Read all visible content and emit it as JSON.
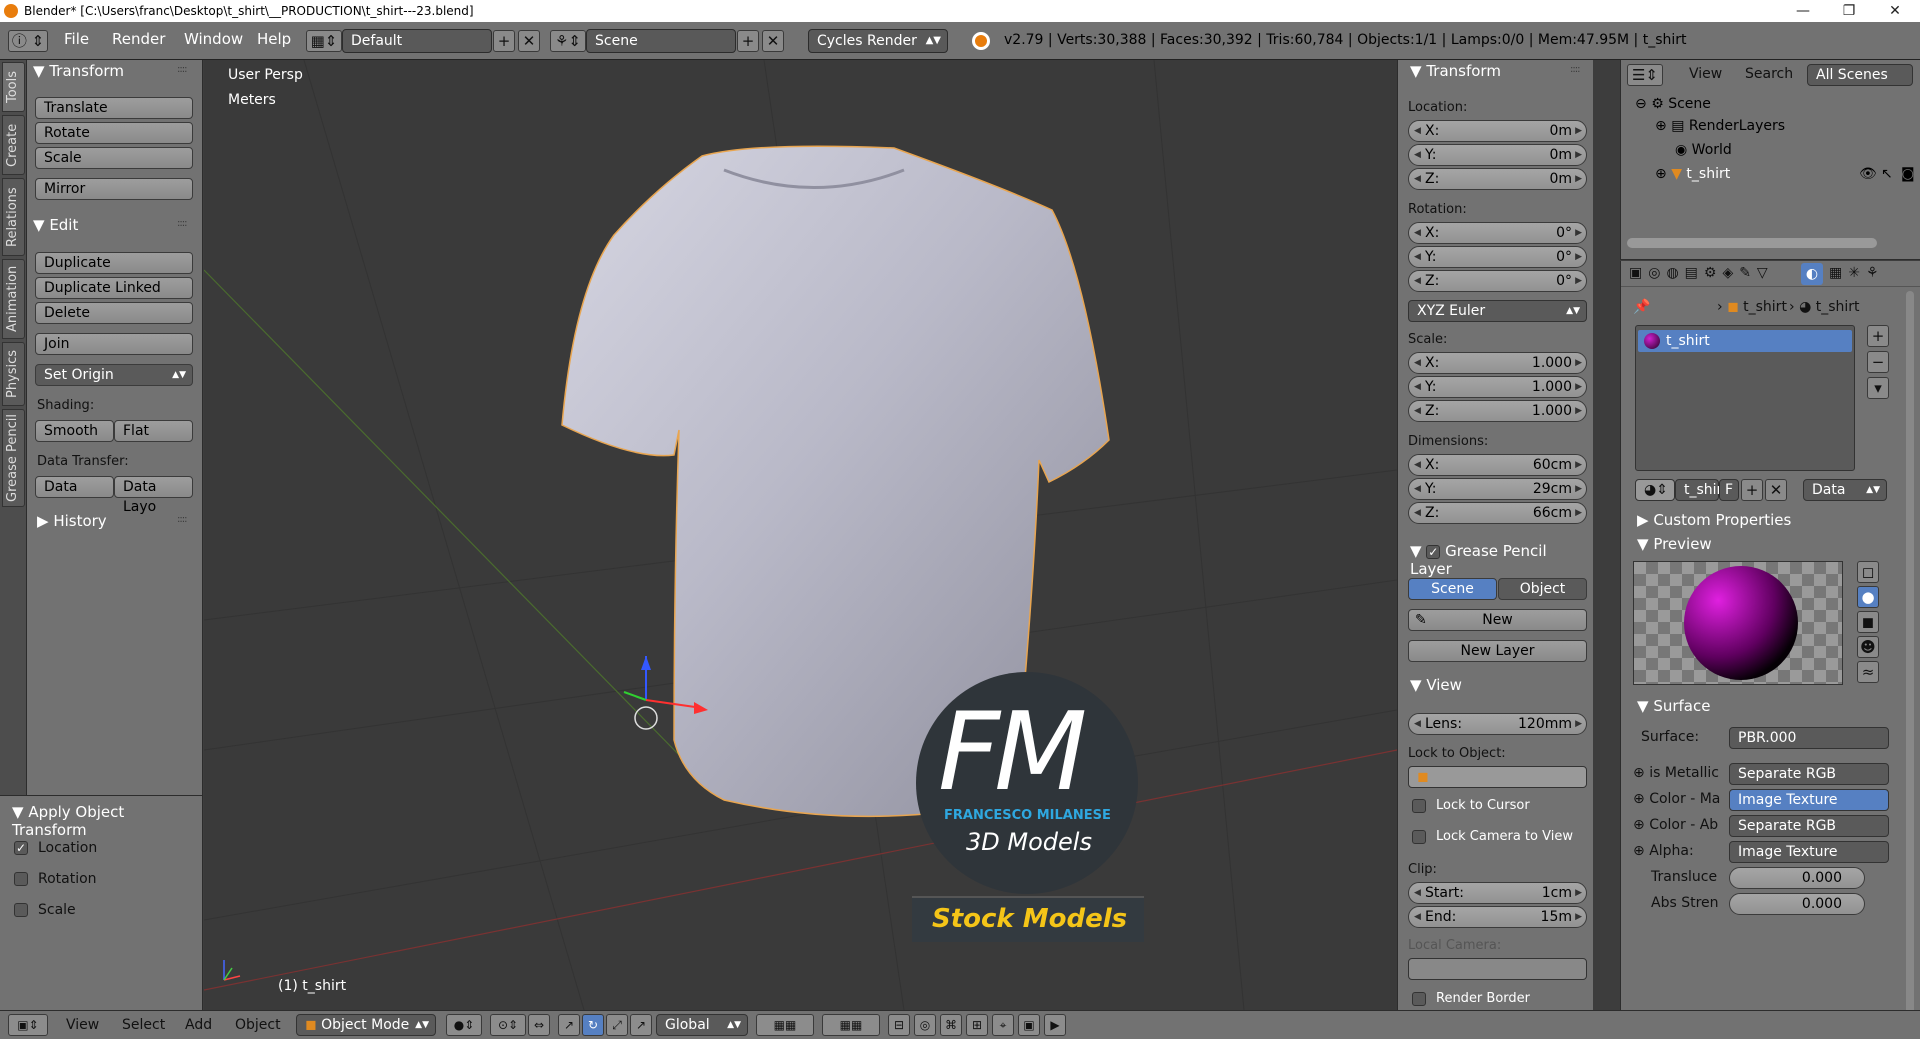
{
  "window": {
    "title": "Blender* [C:\\Users\\franc\\Desktop\\t_shirt\\__PRODUCTION\\t_shirt---23.blend]",
    "minimize": "—",
    "maximize": "❐",
    "close": "✕"
  },
  "infobar": {
    "menus": [
      "File",
      "Render",
      "Window",
      "Help"
    ],
    "screen_layout": "Default",
    "scene": "Scene",
    "engine": "Cycles Render",
    "stats": "v2.79 | Verts:30,388 | Faces:30,392 | Tris:60,784 | Objects:1/1 | Lamps:0/0 | Mem:47.95M | t_shirt"
  },
  "tool_tabs": [
    "Tools",
    "Create",
    "Relations",
    "Animation",
    "Physics",
    "Grease Pencil"
  ],
  "toolshelf": {
    "transform_header": "Transform",
    "transform_buttons": [
      "Translate",
      "Rotate",
      "Scale"
    ],
    "mirror": "Mirror",
    "edit_header": "Edit",
    "edit_buttons": [
      "Duplicate",
      "Duplicate Linked",
      "Delete"
    ],
    "join": "Join",
    "set_origin": "Set Origin",
    "shading_label": "Shading:",
    "smooth": "Smooth",
    "flat": "Flat",
    "data_transfer_label": "Data Transfer:",
    "data": "Data",
    "data_layout": "Data Layo",
    "history": "History"
  },
  "operator_panel": {
    "header": "Apply Object Transform",
    "options": [
      {
        "label": "Location",
        "checked": true
      },
      {
        "label": "Rotation",
        "checked": false
      },
      {
        "label": "Scale",
        "checked": false
      }
    ]
  },
  "viewport": {
    "view_name": "User Persp",
    "units": "Meters",
    "object_label": "(1) t_shirt",
    "watermark_logo": "FM",
    "watermark_name": "FRANCESCO MILANESE",
    "watermark_sub": "3D Models",
    "watermark_stock": "Stock Models"
  },
  "npanel": {
    "transform_header": "Transform",
    "location_label": "Location:",
    "location": [
      {
        "k": "X:",
        "v": "0m"
      },
      {
        "k": "Y:",
        "v": "0m"
      },
      {
        "k": "Z:",
        "v": "0m"
      }
    ],
    "rotation_label": "Rotation:",
    "rotation": [
      {
        "k": "X:",
        "v": "0°"
      },
      {
        "k": "Y:",
        "v": "0°"
      },
      {
        "k": "Z:",
        "v": "0°"
      }
    ],
    "rotation_mode": "XYZ Euler",
    "scale_label": "Scale:",
    "scale": [
      {
        "k": "X:",
        "v": "1.000"
      },
      {
        "k": "Y:",
        "v": "1.000"
      },
      {
        "k": "Z:",
        "v": "1.000"
      }
    ],
    "dimensions_label": "Dimensions:",
    "dimensions": [
      {
        "k": "X:",
        "v": "60cm"
      },
      {
        "k": "Y:",
        "v": "29cm"
      },
      {
        "k": "Z:",
        "v": "66cm"
      }
    ],
    "gp_header": "Grease Pencil Layer",
    "gp_scene": "Scene",
    "gp_object": "Object",
    "gp_new": "New",
    "gp_new_layer": "New Layer",
    "view_header": "View",
    "lens_k": "Lens:",
    "lens_v": "120mm",
    "lock_object_label": "Lock to Object:",
    "lock_cursor": "Lock to Cursor",
    "lock_camera": "Lock Camera to View",
    "clip_label": "Clip:",
    "clip_start_k": "Start:",
    "clip_start_v": "1cm",
    "clip_end_k": "End:",
    "clip_end_v": "15m",
    "local_camera": "Local Camera:",
    "render_border": "Render Border"
  },
  "outliner": {
    "menus": [
      "View",
      "Search"
    ],
    "filter": "All Scenes",
    "tree": [
      {
        "label": "Scene",
        "level": 0
      },
      {
        "label": "RenderLayers",
        "level": 1
      },
      {
        "label": "World",
        "level": 1
      },
      {
        "label": "t_shirt",
        "level": 1
      }
    ]
  },
  "properties": {
    "breadcrumb": [
      "t_shirt",
      "t_shirt"
    ],
    "material_slot": "t_shirt",
    "mat_name": "t_shir",
    "mat_fake": "F",
    "link_mode": "Data",
    "custom_props": "Custom Properties",
    "preview": "Preview",
    "surface_header": "Surface",
    "surface_label": "Surface:",
    "surface_value": "PBR.000",
    "rows": [
      {
        "k": "is Metallic",
        "v": "Separate RGB"
      },
      {
        "k": "Color - Ma",
        "v": "Image Texture"
      },
      {
        "k": "Color - Ab",
        "v": "Separate RGB"
      },
      {
        "k": "Alpha:",
        "v": "Image Texture"
      }
    ],
    "translucent_k": "Transluce",
    "translucent_v": "0.000",
    "abs_k": "Abs Stren",
    "abs_v": "0.000"
  },
  "bottombar": {
    "menus": [
      "View",
      "Select",
      "Add",
      "Object"
    ],
    "mode": "Object Mode",
    "orientation": "Global"
  },
  "colors": {
    "panel": "#727272",
    "viewport_bg": "#3a3a3a",
    "selection_blue": "#5680c2",
    "object_outline": "#e8a550",
    "watermark_blue": "#2fa8e0",
    "watermark_yellow": "#f5c518"
  }
}
